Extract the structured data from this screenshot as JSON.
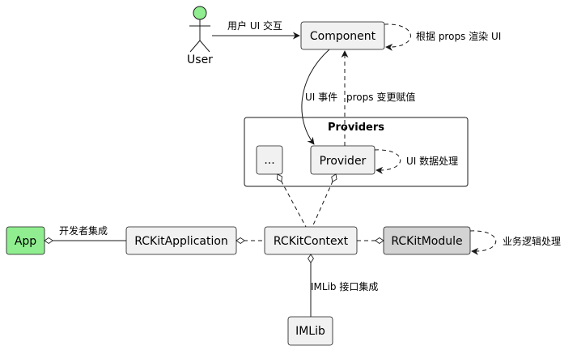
{
  "colors": {
    "node_fill": "#f1f1f1",
    "node_stroke": "#181818",
    "app_fill": "#90ee90",
    "module_fill": "#d3d3d3",
    "actor_fill": "#90ee90",
    "background": "#ffffff"
  },
  "actor": {
    "label": "User"
  },
  "nodes": {
    "component": "Component",
    "provider": "Provider",
    "ellipsis": "...",
    "context": "RCKitContext",
    "application": "RCKitApplication",
    "app": "App",
    "module": "RCKitModule",
    "imlib": "IMLib"
  },
  "group": {
    "title": "Providers"
  },
  "edges": {
    "user_to_component": "用户 UI 交互",
    "component_self": "根据 props 渲染 UI",
    "component_to_provider": "UI 事件",
    "provider_to_component": "props 变更赋值",
    "provider_self": "UI 数据处理",
    "app_application": "开发者集成",
    "module_self": "业务逻辑处理",
    "context_imlib": "IMLib 接口集成"
  }
}
